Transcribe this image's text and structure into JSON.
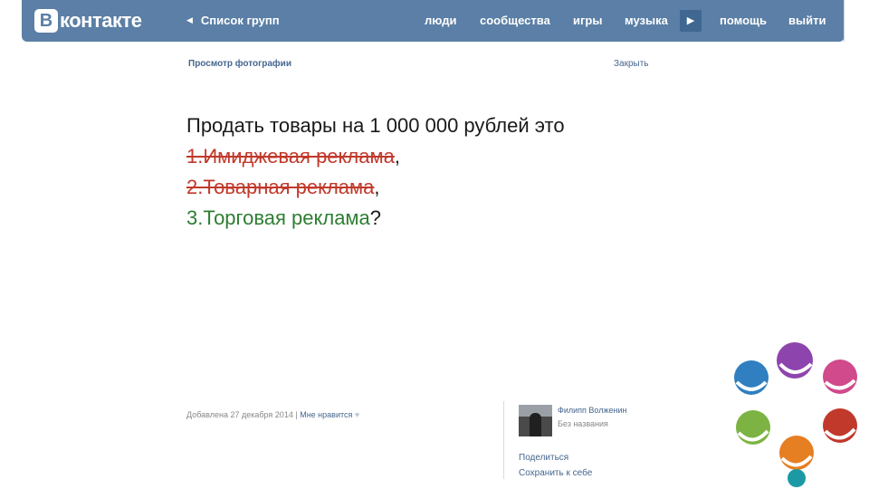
{
  "header": {
    "logo_mark": "В",
    "logo_text": "контакте",
    "back_label": "Список групп",
    "nav": [
      "люди",
      "сообщества",
      "игры",
      "музыка",
      "помощь",
      "выйти"
    ]
  },
  "viewer": {
    "title": "Просмотр фотографии",
    "close": "Закрыть"
  },
  "slide": {
    "line1": "Продать товары на 1 000 000 рублей это",
    "item1": "1.Имиджевая реклама",
    "item2": "2.Товарная реклама",
    "item3": "3.Торговая реклама",
    "comma": ",",
    "question": "?"
  },
  "meta": {
    "added": "Добавлена 27 декабря 2014",
    "separator": "|",
    "like": "Мне нравится"
  },
  "owner": {
    "name": "Филипп Волженин",
    "album": "Без названия"
  },
  "actions": {
    "share": "Поделиться",
    "save": "Сохранить к себе"
  },
  "colors": {
    "header_bg": "#5b7fa6",
    "link": "#45668e",
    "strike_red": "#c0392b",
    "green": "#2e7d32"
  },
  "icons": {
    "back": "back-triangle-icon",
    "play": "play-icon",
    "like": "heart-icon"
  }
}
